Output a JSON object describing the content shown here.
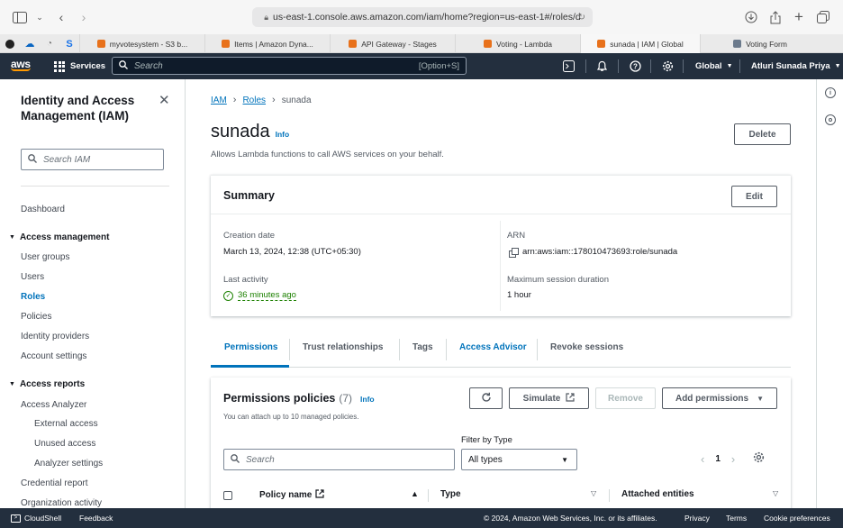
{
  "browser": {
    "url": "us-east-1.console.aws.amazon.com/iam/home?region=us-east-1#/roles/d",
    "tabs": [
      {
        "label": "myvotesystem - S3 b..."
      },
      {
        "label": "Items | Amazon Dyna..."
      },
      {
        "label": "API Gateway - Stages"
      },
      {
        "label": "Voting - Lambda"
      },
      {
        "label": "sunada | IAM | Global"
      },
      {
        "label": "Voting Form"
      }
    ]
  },
  "awsnav": {
    "logo": "aws",
    "services": "Services",
    "search_placeholder": "Search",
    "shortcut": "[Option+S]",
    "region": "Global",
    "user": "Atluri Sunada Priya"
  },
  "sidebar": {
    "title": "Identity and Access Management (IAM)",
    "search_placeholder": "Search IAM",
    "dashboard": "Dashboard",
    "access_management": {
      "heading": "Access management",
      "items": [
        "User groups",
        "Users",
        "Roles",
        "Policies",
        "Identity providers",
        "Account settings"
      ]
    },
    "access_reports": {
      "heading": "Access reports",
      "items": [
        "Access Analyzer"
      ],
      "subitems": [
        "External access",
        "Unused access",
        "Analyzer settings"
      ],
      "more": [
        "Credential report",
        "Organization activity"
      ]
    }
  },
  "main": {
    "breadcrumb": [
      "IAM",
      "Roles",
      "sunada"
    ],
    "role_name": "sunada",
    "info": "Info",
    "description": "Allows Lambda functions to call AWS services on your behalf.",
    "delete": "Delete",
    "summary": {
      "title": "Summary",
      "edit": "Edit",
      "creation_label": "Creation date",
      "creation_value": "March 13, 2024, 12:38 (UTC+05:30)",
      "activity_label": "Last activity",
      "activity_value": "36 minutes ago",
      "arn_label": "ARN",
      "arn_value": "arn:aws:iam::178010473693:role/sunada",
      "duration_label": "Maximum session duration",
      "duration_value": "1 hour"
    },
    "tabs": [
      "Permissions",
      "Trust relationships",
      "Tags",
      "Access Advisor",
      "Revoke sessions"
    ],
    "permissions": {
      "title": "Permissions policies",
      "count": "(7)",
      "info": "Info",
      "subtitle": "You can attach up to 10 managed policies.",
      "simulate": "Simulate",
      "remove": "Remove",
      "add": "Add permissions",
      "filter_label": "Filter by Type",
      "search_placeholder": "Search",
      "type_value": "All types",
      "page": "1",
      "columns": [
        "Policy name",
        "Type",
        "Attached entities"
      ]
    }
  },
  "footer": {
    "cloudshell": "CloudShell",
    "feedback": "Feedback",
    "copyright": "© 2024, Amazon Web Services, Inc. or its affiliates.",
    "privacy": "Privacy",
    "terms": "Terms",
    "cookies": "Cookie preferences"
  }
}
